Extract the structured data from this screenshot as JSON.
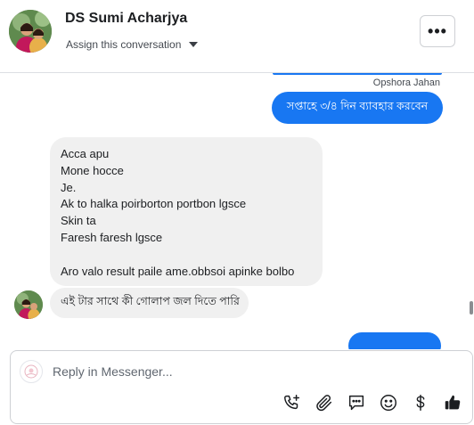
{
  "header": {
    "contact_name": "DS Sumi Acharjya",
    "assign_label": "Assign this conversation",
    "more_label": "•••"
  },
  "conversation": {
    "sender_label": "Opshora Jahan",
    "outgoing_message": "সপ্তাহে ৩/৪ দিন ব্যাবহার করবেন",
    "incoming_message_lines": [
      "Acca apu",
      "Mone hocce",
      "Je.",
      "Ak to halka poirborton portbon lgsce",
      "Skin ta",
      "Faresh faresh lgsce",
      "",
      "Aro valo result paile ame.obbsoi apinke bolbo"
    ],
    "incoming_message_2": "এই টার সাথে কী গোলাপ জল দিতে পারি"
  },
  "composer": {
    "placeholder": "Reply in Messenger...",
    "tools": [
      "call-add-icon",
      "paperclip-icon",
      "saved-reply-icon",
      "emoji-icon",
      "dollar-icon",
      "thumbs-up-icon"
    ]
  },
  "colors": {
    "accent": "#1877f2",
    "incoming_bubble": "#f0f0f0"
  }
}
